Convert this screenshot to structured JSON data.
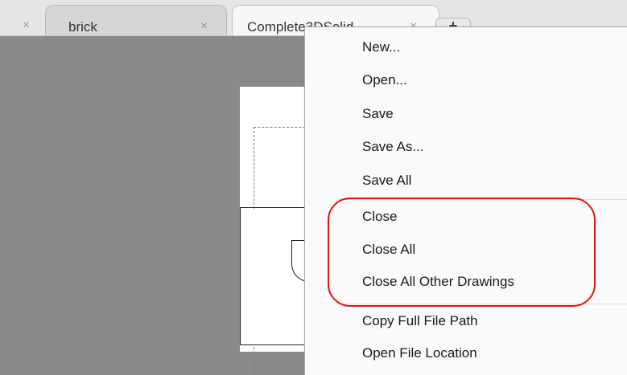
{
  "tabs": [
    {
      "label": "",
      "close": "×"
    },
    {
      "label": "brick",
      "close": "×"
    },
    {
      "label": "Complete3DSolid",
      "close": "×"
    }
  ],
  "newtab": {
    "label": "+"
  },
  "menu": {
    "items": [
      {
        "label": "New..."
      },
      {
        "label": "Open..."
      },
      {
        "label": "Save"
      },
      {
        "label": "Save As..."
      },
      {
        "label": "Save All"
      },
      {
        "label": "Close"
      },
      {
        "label": "Close All"
      },
      {
        "label": "Close All Other Drawings"
      },
      {
        "label": "Copy Full File Path"
      },
      {
        "label": "Open File Location"
      }
    ]
  },
  "colors": {
    "highlight": "#e41414",
    "canvas": "#8a8a8a"
  }
}
